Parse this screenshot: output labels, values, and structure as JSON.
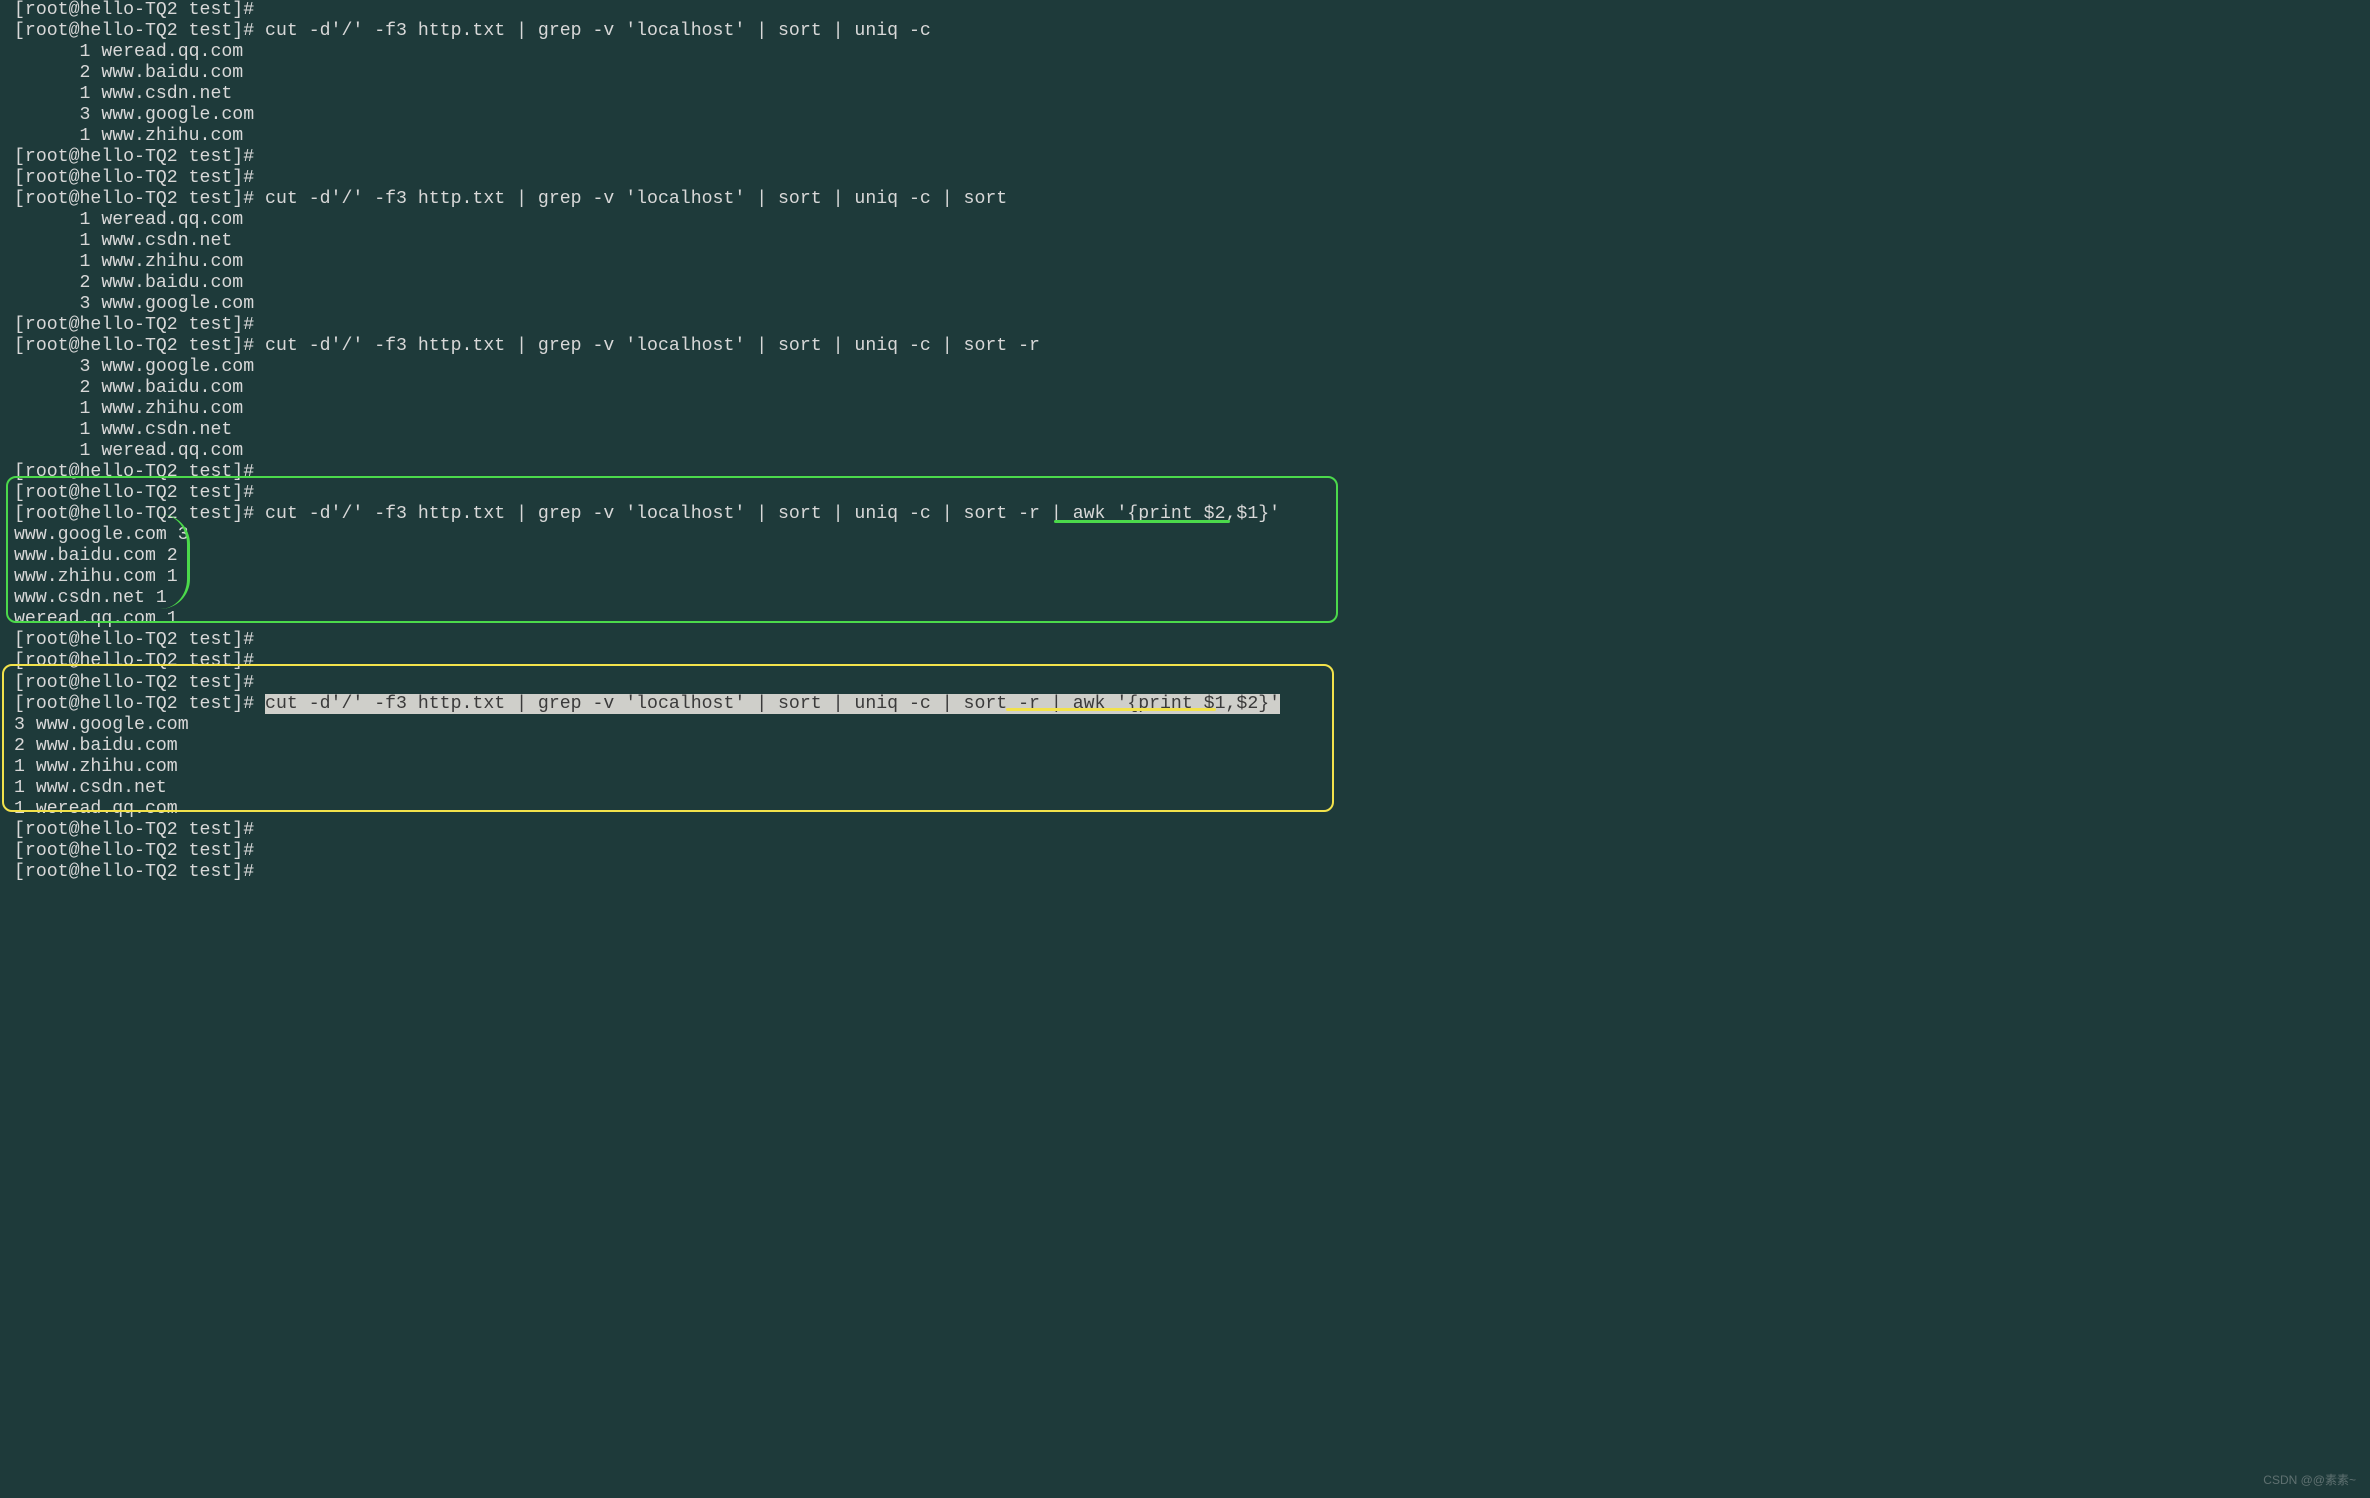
{
  "prompt": "[root@hello-TQ2 test]#",
  "commands": {
    "c1": "cut -d'/' -f3 http.txt | grep -v 'localhost' | sort | uniq -c",
    "c2": "cut -d'/' -f3 http.txt | grep -v 'localhost' | sort | uniq -c | sort",
    "c3": "cut -d'/' -f3 http.txt | grep -v 'localhost' | sort | uniq -c | sort -r",
    "c4": "cut -d'/' -f3 http.txt | grep -v 'localhost' | sort | uniq -c | sort -r | awk '{print $2,$1}'",
    "c5": "cut -d'/' -f3 http.txt | grep -v 'localhost' | sort | uniq -c | sort -r | awk '{print $1,$2}'"
  },
  "output1": [
    "      1 weread.qq.com",
    "      2 www.baidu.com",
    "      1 www.csdn.net",
    "      3 www.google.com",
    "      1 www.zhihu.com"
  ],
  "output2": [
    "      1 weread.qq.com",
    "      1 www.csdn.net",
    "      1 www.zhihu.com",
    "      2 www.baidu.com",
    "      3 www.google.com"
  ],
  "output3": [
    "      3 www.google.com",
    "      2 www.baidu.com",
    "      1 www.zhihu.com",
    "      1 www.csdn.net",
    "      1 weread.qq.com"
  ],
  "output4": [
    "www.google.com 3",
    "www.baidu.com 2",
    "www.zhihu.com 1",
    "www.csdn.net 1",
    "weread.qq.com 1"
  ],
  "output5": [
    "3 www.google.com",
    "2 www.baidu.com",
    "1 www.zhihu.com",
    "1 www.csdn.net",
    "1 weread.qq.com"
  ],
  "watermark": "CSDN @@素素~"
}
